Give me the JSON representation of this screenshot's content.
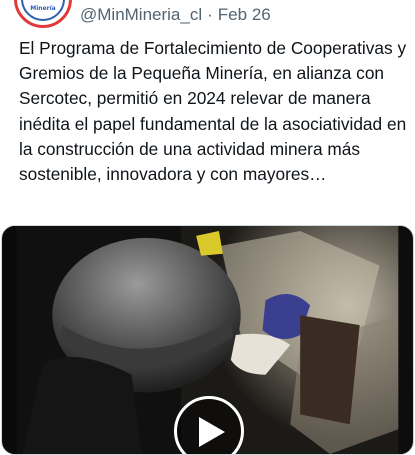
{
  "tweet": {
    "avatar_text": "Minería",
    "handle": "@MinMineria_cl",
    "separator": "·",
    "date": "Feb 26",
    "text": "El Programa de Fortalecimiento de Cooperativas y Gremios de la Pequeña Minería, en alianza con Sercotec, permitió en 2024 relevar de manera inédita el papel fundamental de la asociatividad en la construcción de una actividad minera más sostenible, innovadora y con mayores…"
  },
  "icons": {
    "play": "play-icon",
    "avatar": "ministry-logo-icon"
  },
  "colors": {
    "text": "#0f1419",
    "secondary": "#536471",
    "logo_red": "#e23a3a",
    "logo_blue": "#2f5fb0"
  }
}
